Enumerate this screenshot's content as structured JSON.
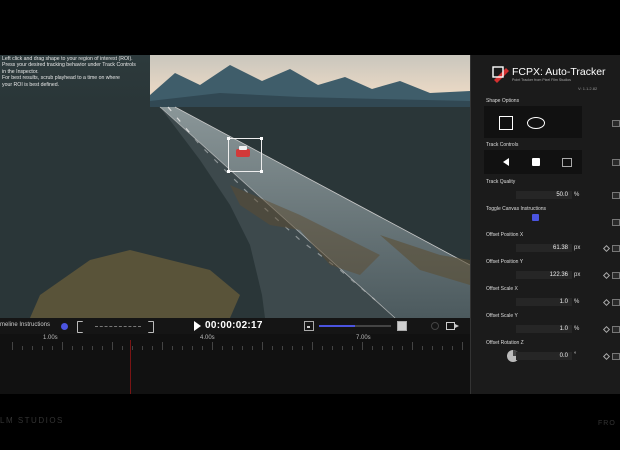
{
  "viewer": {
    "instructions": [
      "Left click and drag shape to your region of interest (ROI).",
      "Press your desired tracking behavior under Track Controls",
      "in the Inspector.",
      "For best results, scrub playhead to a time on where",
      "your ROI is best defined."
    ]
  },
  "controls": {
    "timeline_label": "meline Instructions",
    "timecode": "00:00:02:17",
    "zoom_level": 0.5,
    "accent_color": "#4b54e0"
  },
  "ruler": {
    "labels": [
      "1.00s",
      "4.00s",
      "7.00s"
    ]
  },
  "inspector": {
    "title": "FCPX: Auto-Tracker",
    "subtitle": "Point Tracker from Pixel Film Studios",
    "version": "V: 1.1.2.82",
    "shape_options_label": "Shape Options",
    "track_controls_label": "Track Controls",
    "track_quality": {
      "label": "Track Quality",
      "value": "50.0",
      "unit": "%"
    },
    "toggle_canvas": {
      "label": "Toggle Canvas Instructions",
      "checked": true
    },
    "offset_x": {
      "label": "Offset Position X",
      "value": "61.38",
      "unit": "px"
    },
    "offset_y": {
      "label": "Offset Position Y",
      "value": "122.36",
      "unit": "px"
    },
    "scale_x": {
      "label": "Offset Scale X",
      "value": "1.0",
      "unit": "%"
    },
    "scale_y": {
      "label": "Offset Scale Y",
      "value": "1.0",
      "unit": "%"
    },
    "rotation": {
      "label": "Offset Rotation Z",
      "value": "0.0",
      "unit": "°"
    }
  },
  "footer": {
    "watermark_left": "LM STUDIOS",
    "watermark_right": "FRO"
  }
}
